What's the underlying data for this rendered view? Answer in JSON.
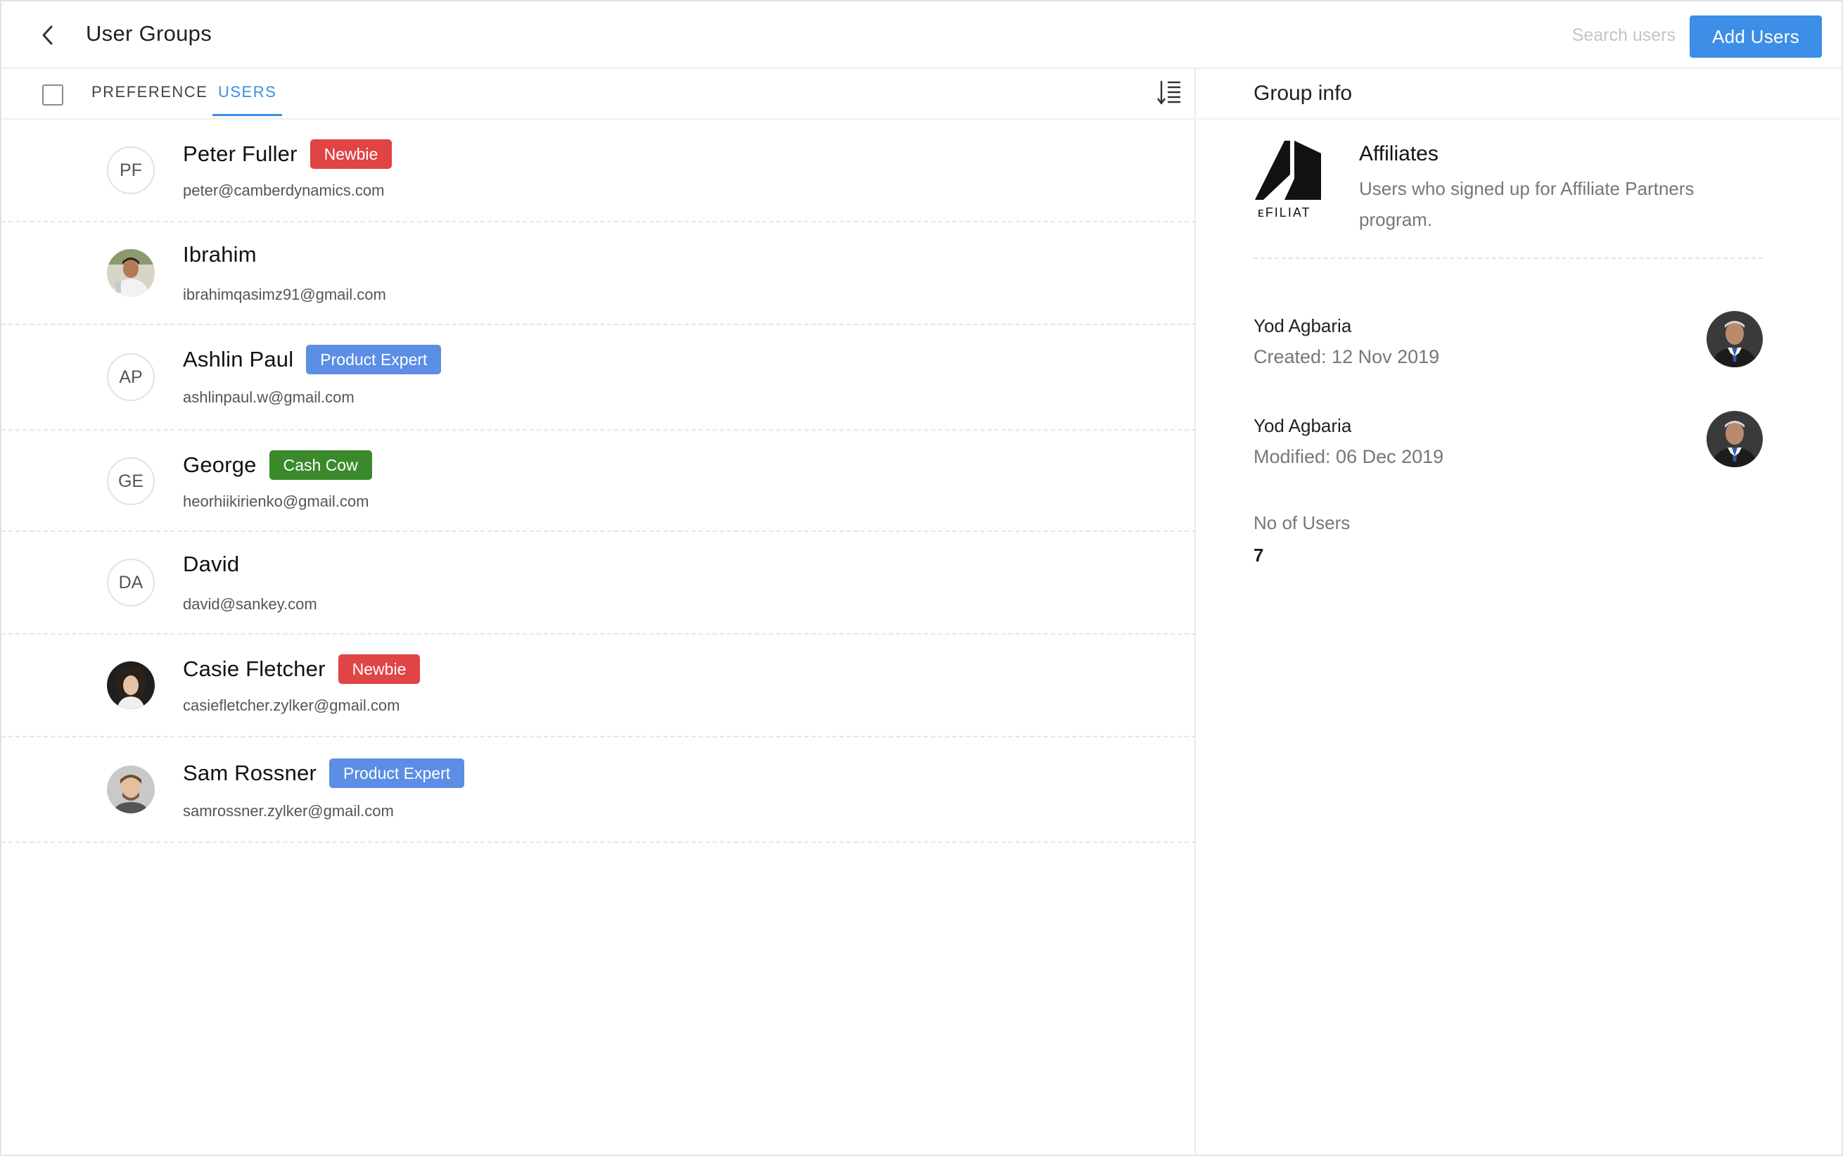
{
  "header": {
    "title": "User Groups",
    "search_placeholder": "Search users",
    "add_button": "Add Users"
  },
  "tabs": [
    {
      "label": "PREFERENCE",
      "active": false
    },
    {
      "label": "USERS",
      "active": true
    }
  ],
  "users": [
    {
      "name": "Peter Fuller",
      "email": "peter@camberdynamics.com",
      "initials": "PF",
      "badge": "Newbie",
      "badge_color": "#e04444"
    },
    {
      "name": "Ibrahim",
      "email": "ibrahimqasimz91@gmail.com",
      "initials": "",
      "badge": "",
      "badge_color": ""
    },
    {
      "name": "Ashlin Paul",
      "email": "ashlinpaul.w@gmail.com",
      "initials": "AP",
      "badge": "Product Expert",
      "badge_color": "#5b8ee4"
    },
    {
      "name": "George",
      "email": "heorhiikirienko@gmail.com",
      "initials": "GE",
      "badge": "Cash Cow",
      "badge_color": "#3a8a2c"
    },
    {
      "name": "David",
      "email": "david@sankey.com",
      "initials": "DA",
      "badge": "",
      "badge_color": ""
    },
    {
      "name": "Casie Fletcher",
      "email": "casiefletcher.zylker@gmail.com",
      "initials": "",
      "badge": "Newbie",
      "badge_color": "#e04444"
    },
    {
      "name": "Sam Rossner",
      "email": "samrossner.zylker@gmail.com",
      "initials": "",
      "badge": "Product Expert",
      "badge_color": "#5b8ee4"
    }
  ],
  "group_info": {
    "title": "Group info",
    "logo_text": "ᴇFILIAT",
    "name": "Affiliates",
    "description": "Users who signed up for Affiliate Partners program.",
    "created_by": "Yod Agbaria",
    "created": "Created: 12 Nov 2019",
    "modified_by": "Yod Agbaria",
    "modified": "Modified: 06 Dec 2019",
    "count_label": "No of Users",
    "count": "7"
  },
  "colors": {
    "accent": "#3d8ee6",
    "newbie": "#e04444",
    "product_expert": "#5b8ee4",
    "cash_cow": "#3a8a2c"
  }
}
